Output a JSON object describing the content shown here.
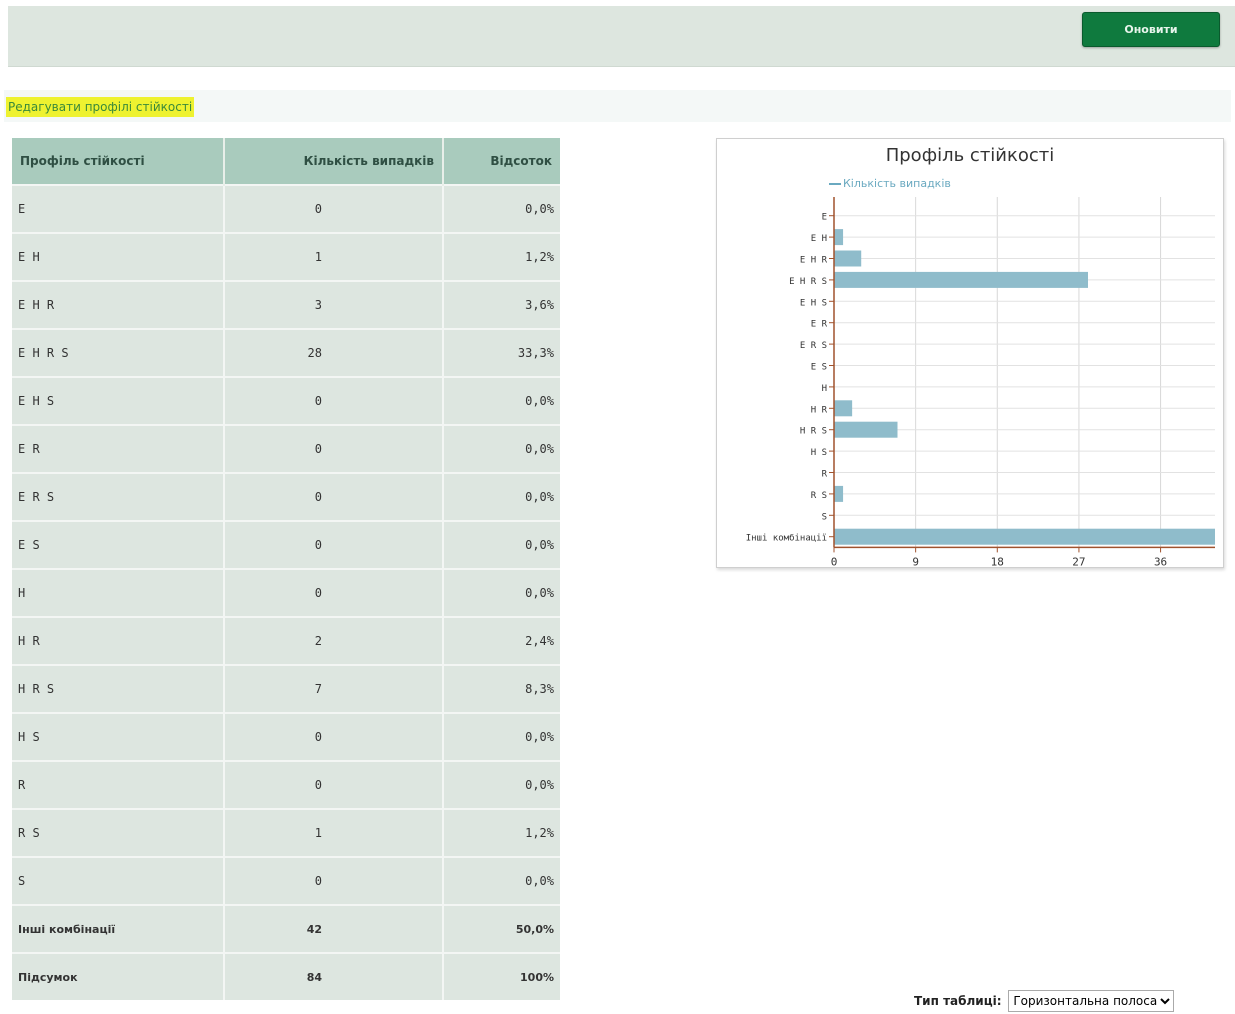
{
  "toolbar": {
    "refresh_label": "Оновити"
  },
  "edit_link": "Редагувати профілі стійкості",
  "table": {
    "headers": [
      "Профіль стійкості",
      "Кількість випадків",
      "Відсоток"
    ],
    "rows": [
      [
        "E",
        "0",
        "0,0%"
      ],
      [
        "E H",
        "1",
        "1,2%"
      ],
      [
        "E H R",
        "3",
        "3,6%"
      ],
      [
        "E H R S",
        "28",
        "33,3%"
      ],
      [
        "E H S",
        "0",
        "0,0%"
      ],
      [
        "E R",
        "0",
        "0,0%"
      ],
      [
        "E R S",
        "0",
        "0,0%"
      ],
      [
        "E S",
        "0",
        "0,0%"
      ],
      [
        "H",
        "0",
        "0,0%"
      ],
      [
        "H R",
        "2",
        "2,4%"
      ],
      [
        "H R S",
        "7",
        "8,3%"
      ],
      [
        "H S",
        "0",
        "0,0%"
      ],
      [
        "R",
        "0",
        "0,0%"
      ],
      [
        "R S",
        "1",
        "1,2%"
      ],
      [
        "S",
        "0",
        "0,0%"
      ]
    ],
    "other_row": [
      "Інші комбінації",
      "42",
      "50,0%"
    ],
    "total_row": [
      "Підсумок",
      "84",
      "100%"
    ]
  },
  "chart_data": {
    "type": "bar",
    "title": "Профіль стійкості",
    "legend": [
      "Кількість випадків"
    ],
    "categories": [
      "E",
      "E H",
      "E H R",
      "E H R S",
      "E H S",
      "E R",
      "E R S",
      "E S",
      "H",
      "H R",
      "H R S",
      "H S",
      "R",
      "R S",
      "S",
      "Інші комбінації"
    ],
    "series": [
      {
        "name": "Кількість випадків",
        "values": [
          0,
          1,
          3,
          28,
          0,
          0,
          0,
          0,
          0,
          2,
          7,
          0,
          0,
          1,
          0,
          42
        ]
      }
    ],
    "xticks": [
      0,
      9,
      18,
      27,
      36
    ],
    "xlim": [
      0,
      42
    ],
    "orientation": "horizontal",
    "grid": true,
    "legend_position": "top",
    "color": "#8fbccb"
  },
  "chart_type": {
    "label": "Тип таблиці:",
    "selected": "Горизонтальна полоса"
  }
}
